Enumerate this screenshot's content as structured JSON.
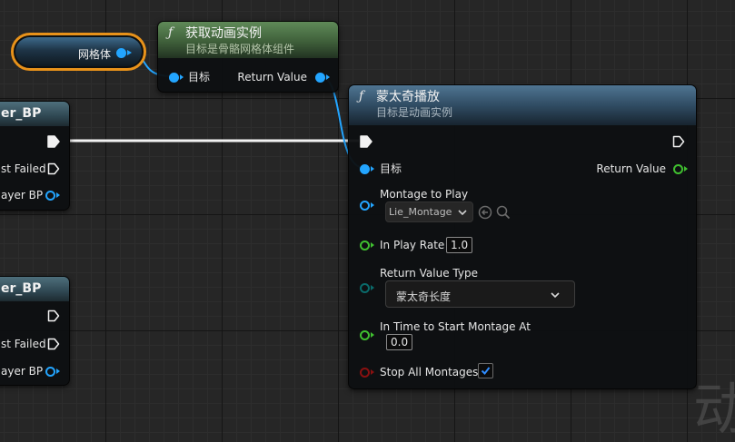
{
  "mesh_node": {
    "label": "网格体"
  },
  "get_anim_node": {
    "title": "获取动画实例",
    "subtitle": "目标是骨骼网格体组件",
    "target_label": "目标",
    "return_label": "Return Value"
  },
  "left_nodes": [
    {
      "title_fragment": "er_BP",
      "failed_label": "st Failed",
      "player_label": "ayer BP"
    },
    {
      "title_fragment": "er_BP",
      "failed_label": "st Failed",
      "player_label": "ayer BP"
    }
  ],
  "montage_node": {
    "title": "蒙太奇播放",
    "subtitle": "目标是动画实例",
    "target_label": "目标",
    "return_label": "Return Value",
    "montage_label": "Montage to Play",
    "montage_value": "Lie_Montage",
    "play_rate_label": "In Play Rate",
    "play_rate_value": "1.0",
    "return_type_label": "Return Value Type",
    "return_type_value": "蒙太奇长度",
    "start_time_label": "In Time to Start Montage At",
    "start_time_value": "0.0",
    "stop_all_label": "Stop All Montages",
    "stop_all_checked": true
  },
  "watermark": "动",
  "colors": {
    "object_pin": "#23a5ff",
    "float_pin": "#40c030",
    "enum_pin": "#0a6a6a",
    "bool_pin": "#8a1010",
    "function_header": "#3b5a72",
    "pure_header": "#4b6e45",
    "variable_outline": "#e8921a"
  }
}
